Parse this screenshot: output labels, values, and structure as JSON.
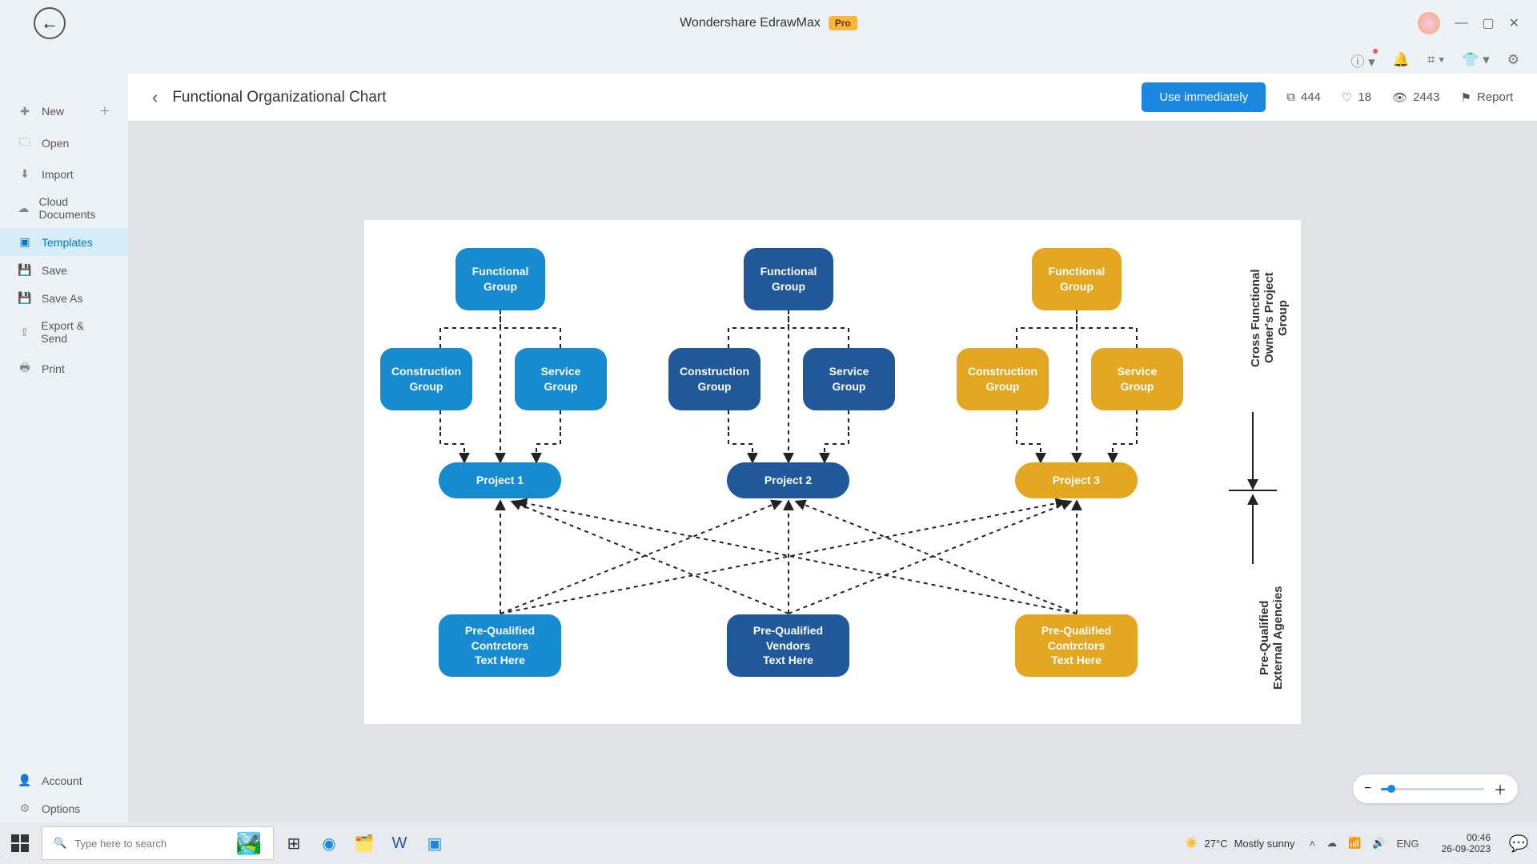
{
  "app": {
    "title": "Wondershare EdrawMax",
    "badge": "Pro"
  },
  "subbar_icons": [
    "help",
    "bell",
    "grid",
    "shirt",
    "gear"
  ],
  "sidebar": {
    "items": [
      {
        "label": "New",
        "icon": "＋",
        "plus": true
      },
      {
        "label": "Open",
        "icon": "🗀"
      },
      {
        "label": "Import",
        "icon": "⬇"
      },
      {
        "label": "Cloud Documents",
        "icon": "☁"
      },
      {
        "label": "Templates",
        "icon": "▣"
      },
      {
        "label": "Save",
        "icon": "💾"
      },
      {
        "label": "Save As",
        "icon": "💾"
      },
      {
        "label": "Export & Send",
        "icon": "⇪"
      },
      {
        "label": "Print",
        "icon": "🖶"
      }
    ],
    "active_index": 4,
    "footer": [
      {
        "label": "Account",
        "icon": "👤"
      },
      {
        "label": "Options",
        "icon": "⚙"
      }
    ]
  },
  "page": {
    "title": "Functional Organizational Chart",
    "use_btn": "Use immediately",
    "copies": "444",
    "likes": "18",
    "views": "2443",
    "report": "Report"
  },
  "chart_data": {
    "type": "org-chart",
    "columns": [
      {
        "color": "blue",
        "functional": "Functional\nGroup",
        "construction": "Construction\nGroup",
        "service": "Service\nGroup",
        "project": "Project 1",
        "prequal": "Pre-Qualified\nContrctors\nText Here"
      },
      {
        "color": "navy",
        "functional": "Functional\nGroup",
        "construction": "Construction\nGroup",
        "service": "Service\nGroup",
        "project": "Project 2",
        "prequal": "Pre-Qualified\nVendors\nText Here"
      },
      {
        "color": "gold",
        "functional": "Functional\nGroup",
        "construction": "Construction\nGroup",
        "service": "Service\nGroup",
        "project": "Project 3",
        "prequal": "Pre-Qualified\nContrctors\nText Here"
      }
    ],
    "side_labels": {
      "upper": "Cross Functional\nOwner's Project\nGroup",
      "lower": "Pre-Qualified\nExternal Agencies"
    }
  },
  "taskbar": {
    "search_placeholder": "Type here to search",
    "weather_temp": "27°C",
    "weather_desc": "Mostly sunny",
    "time": "00:46",
    "date": "26-09-2023"
  }
}
